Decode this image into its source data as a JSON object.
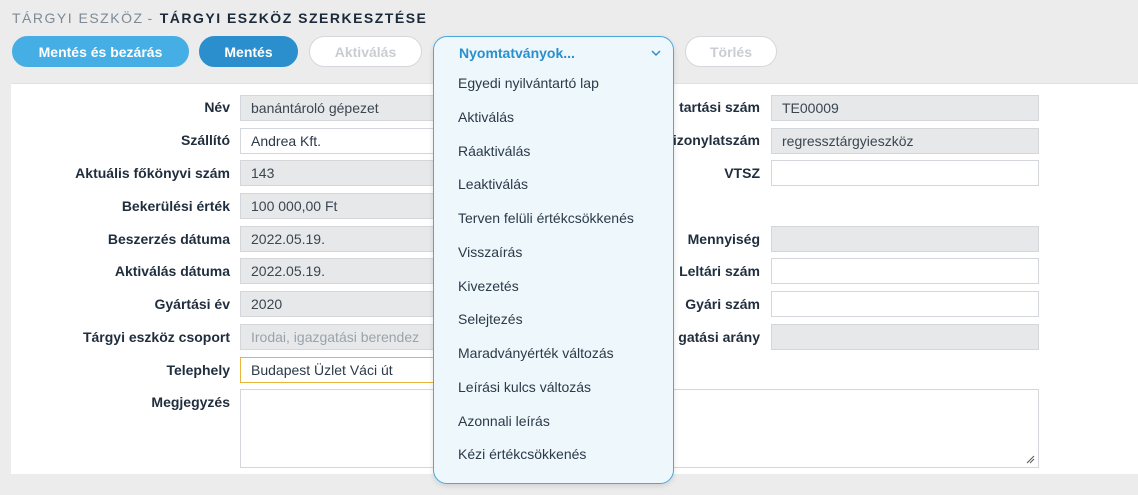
{
  "header": {
    "crumb": "TÁRGYI ESZKÖZ",
    "separator": "-",
    "page_title": "TÁRGYI ESZKÖZ SZERKESZTÉSE"
  },
  "toolbar": {
    "save_close_label": "Mentés és bezárás",
    "save_label": "Mentés",
    "activate_label": "Aktiválás",
    "print_label": "Nyomtatványok...",
    "delete_label": "Törlés"
  },
  "print_menu": {
    "items": [
      "Egyedi nyilvántartó lap",
      "Aktiválás",
      "Ráaktiválás",
      "Leaktiválás",
      "Terven felüli értékcsökkenés",
      "Visszaírás",
      "Kivezetés",
      "Selejtezés",
      "Maradványérték változás",
      "Leírási kulcs változás",
      "Azonnali leírás",
      "Kézi értékcsökkenés"
    ]
  },
  "form_left": {
    "name_label": "Név",
    "name_value": "banántároló gépezet",
    "supplier_label": "Szállító",
    "supplier_value": "Andrea Kft.",
    "ledger_label": "Aktuális főkönyvi szám",
    "ledger_value": "143",
    "cost_label": "Bekerülési érték",
    "cost_value": "100 000,00 Ft",
    "purchase_date_label": "Beszerzés dátuma",
    "purchase_date_value": "2022.05.19.",
    "activation_date_label": "Aktiválás dátuma",
    "activation_date_value": "2022.05.19.",
    "year_label": "Gyártási év",
    "year_value": "2020",
    "group_label": "Tárgyi eszköz csoport",
    "group_value": "Irodai, igazgatási berendez",
    "site_label": "Telephely",
    "site_value": "Budapest Üzlet Váci út",
    "note_label": "Megjegyzés",
    "note_value": ""
  },
  "form_right": {
    "registry_label": "tartási szám",
    "registry_value": "TE00009",
    "voucher_label": "izonylatszám",
    "voucher_value": "regressztárgyieszköz",
    "vtsz_label": "VTSZ",
    "vtsz_value": "",
    "quantity_label": "Mennyiség",
    "quantity_value": "",
    "inventory_label": "Leltári szám",
    "inventory_value": "",
    "serial_label": "Gyári szám",
    "serial_value": "",
    "ratio_label": "gatási arány",
    "ratio_value": ""
  },
  "colors": {
    "accent": "#2a8fcc",
    "accent_light": "#45aee5",
    "dropdown_bg": "#eef7fb",
    "focus_border": "#e8b53a"
  },
  "icons": {
    "dropdown_chevron": "chevron-down-icon",
    "resize": "resize-grip-icon"
  }
}
